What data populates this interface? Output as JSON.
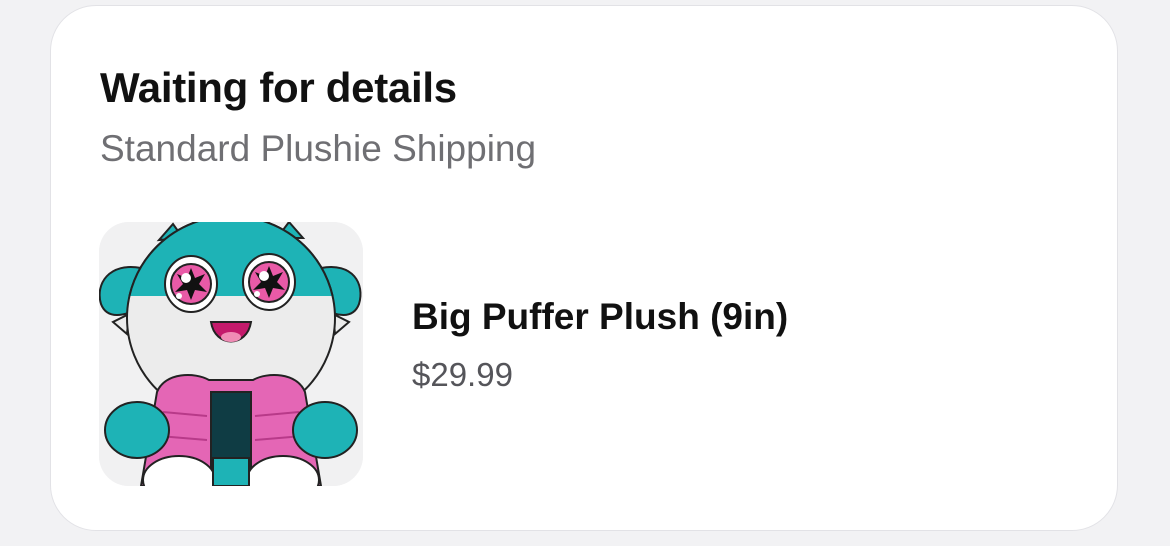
{
  "order": {
    "status_title": "Waiting for details",
    "shipping_method": "Standard Plushie Shipping"
  },
  "item": {
    "name": "Big Puffer Plush (9in)",
    "price": "$29.99",
    "image_icon": "pufferfish-plush-image"
  },
  "colors": {
    "teal": "#1eb3b6",
    "pink": "#e466b5",
    "eye_pink": "#e95aa7"
  }
}
